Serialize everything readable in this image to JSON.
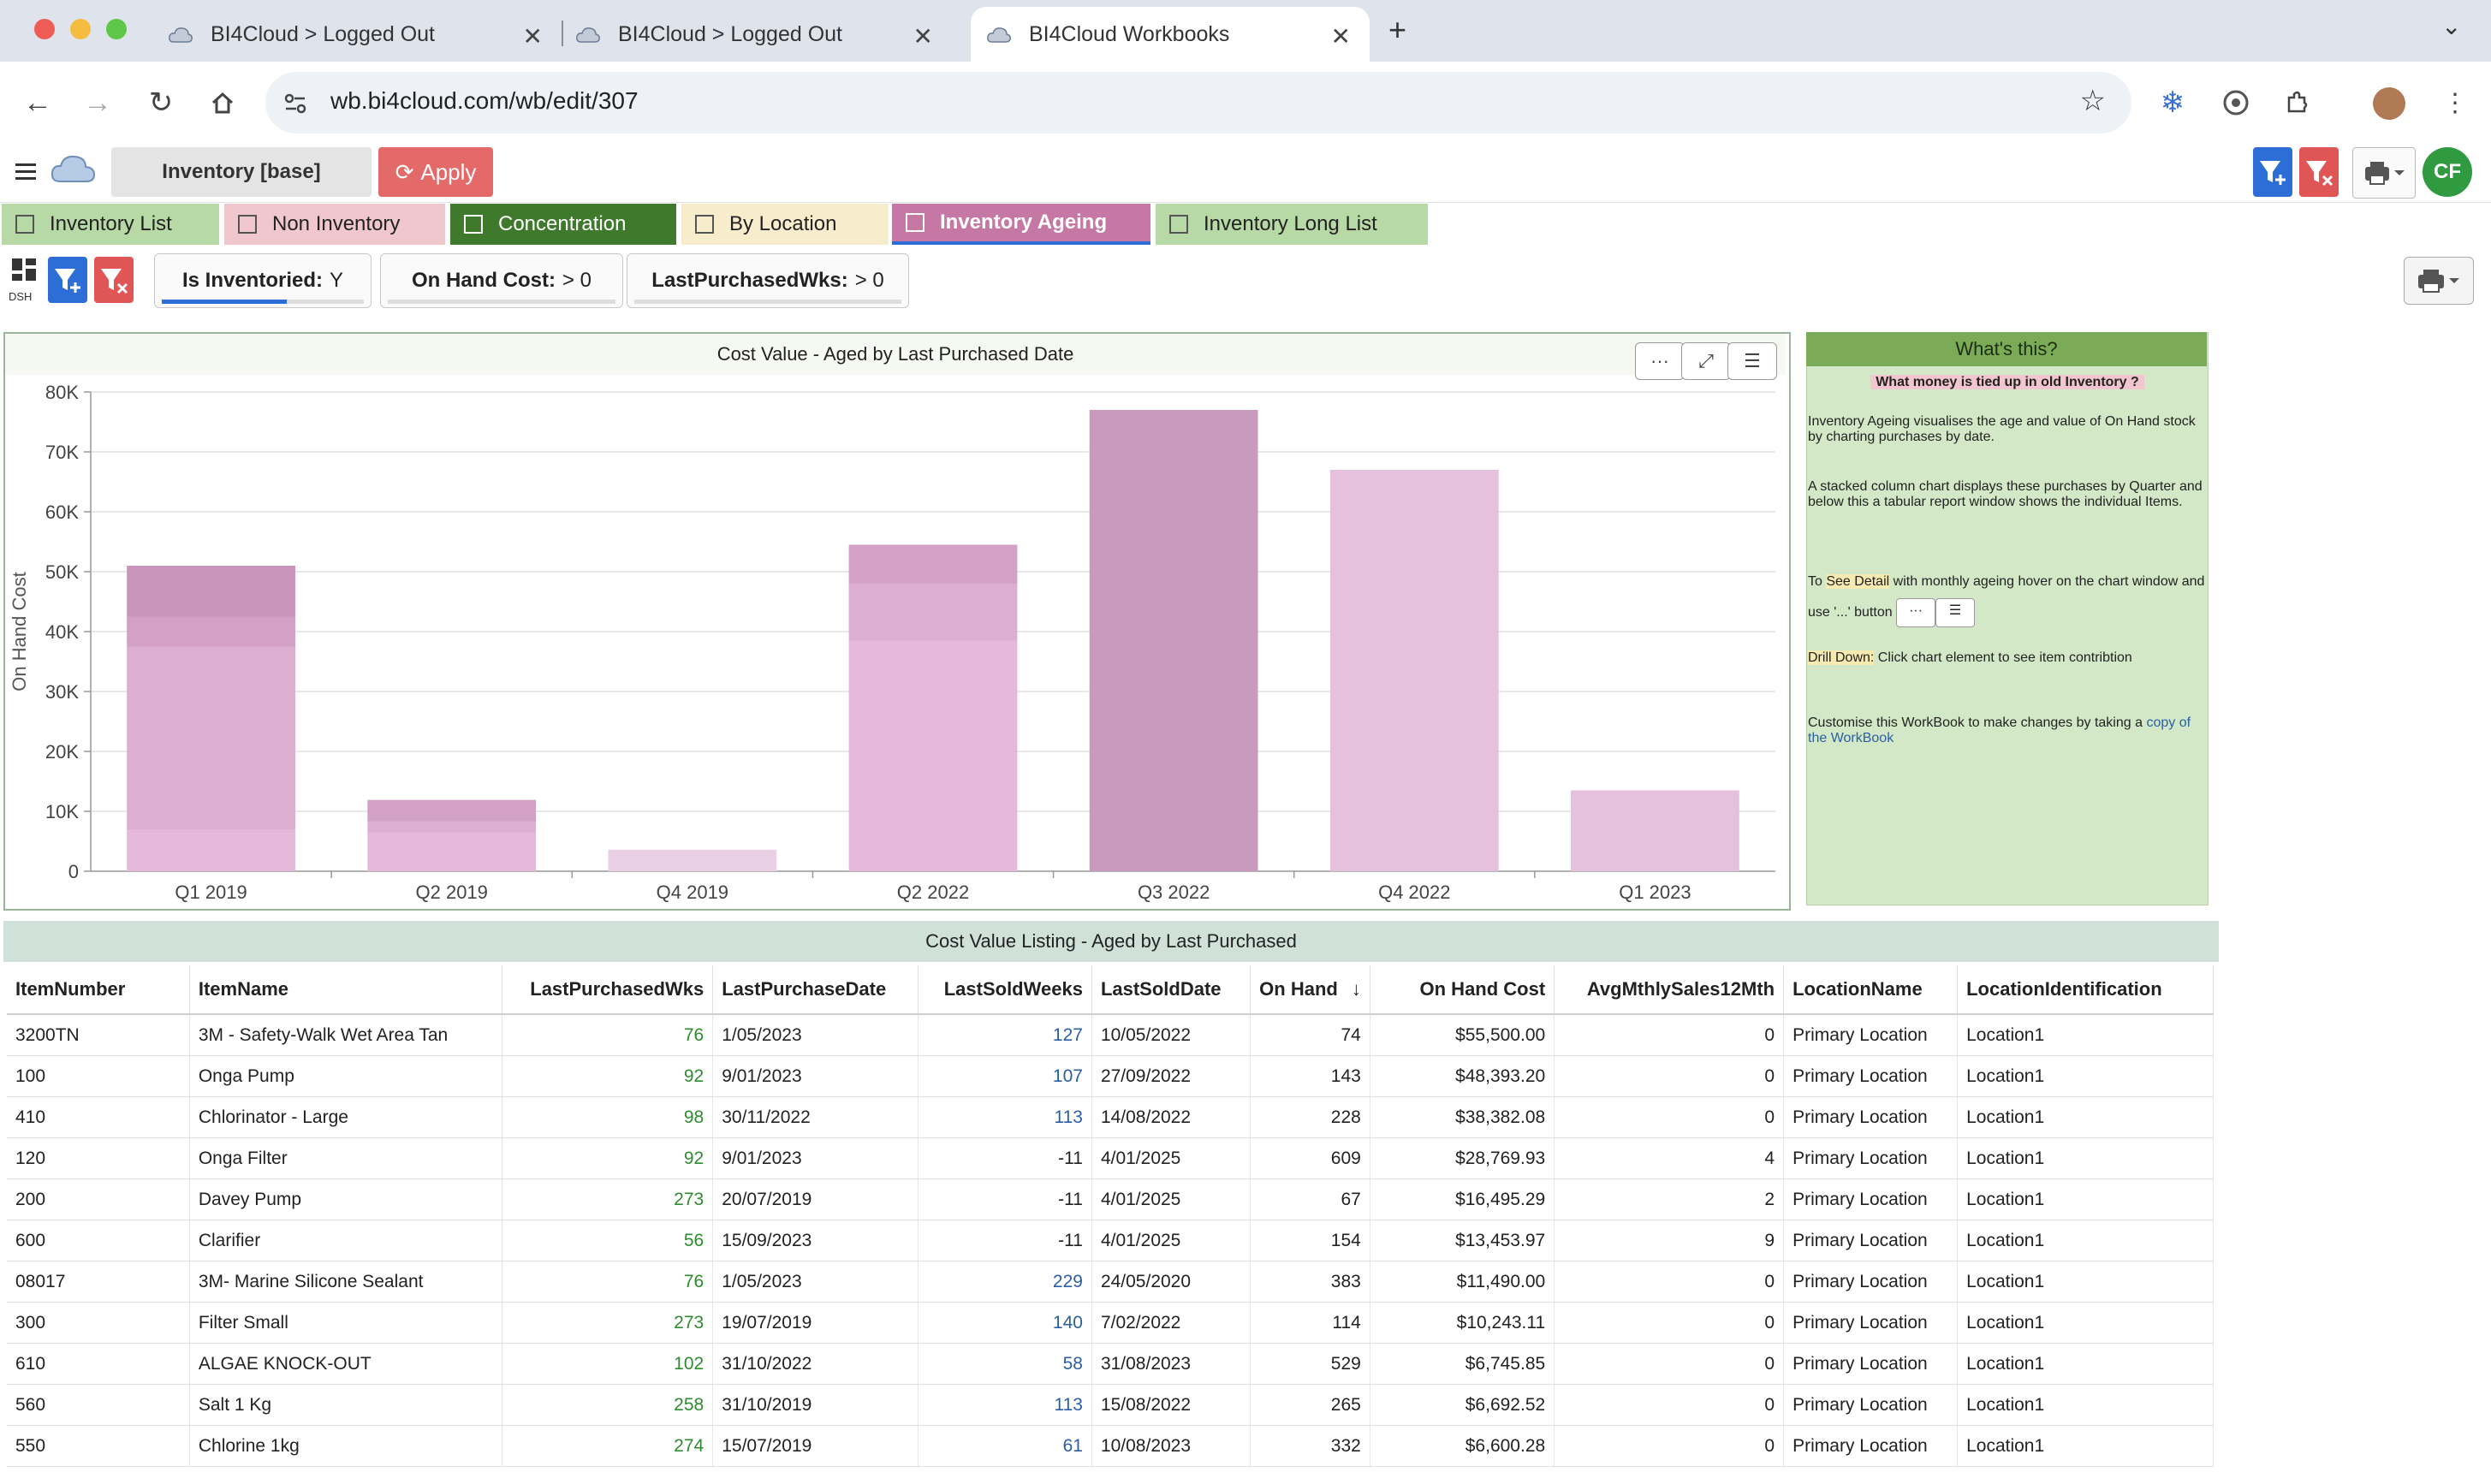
{
  "browser": {
    "tabs": [
      {
        "title": "BI4Cloud > Logged Out"
      },
      {
        "title": "BI4Cloud > Logged Out"
      },
      {
        "title": "BI4Cloud Workbooks"
      }
    ],
    "url": "wb.bi4cloud.com/wb/edit/307"
  },
  "app": {
    "workbook_name": "Inventory [base]",
    "apply_label": "Apply",
    "avatar_initials": "CF",
    "dsh_label": "DSH"
  },
  "workbook_tabs": [
    {
      "label": "Inventory List",
      "color": "#b7d9a5"
    },
    {
      "label": "Non Inventory",
      "color": "#efc7cc"
    },
    {
      "label": "Concentration",
      "color": "#3f7a2c"
    },
    {
      "label": "By Location",
      "color": "#f7eccb"
    },
    {
      "label": "Inventory Ageing",
      "color": "#c678a5"
    },
    {
      "label": "Inventory Long List",
      "color": "#b7d9a5"
    }
  ],
  "filters": [
    {
      "name": "Is Inventoried:",
      "value": "Y"
    },
    {
      "name": "On Hand Cost:",
      "value": "> 0"
    },
    {
      "name": "LastPurchasedWks:",
      "value": "> 0"
    }
  ],
  "chart_data": {
    "type": "bar",
    "title": "Cost Value - Aged by Last Purchased Date",
    "xlabel": "",
    "ylabel": "On Hand Cost",
    "ylim": [
      0,
      80000
    ],
    "yticks": [
      "0",
      "10K",
      "20K",
      "30K",
      "40K",
      "50K",
      "60K",
      "70K",
      "80K"
    ],
    "categories": [
      "Q1 2019",
      "Q2 2019",
      "Q4 2019",
      "Q2 2022",
      "Q3 2022",
      "Q4 2022",
      "Q1 2023"
    ],
    "stacked": true,
    "stacks": [
      [
        7000,
        30500,
        5000,
        8500
      ],
      [
        6500,
        1800,
        3600
      ],
      [
        3600
      ],
      [
        38500,
        9500,
        6500
      ],
      [
        77000
      ],
      [
        67000
      ],
      [
        13500
      ]
    ],
    "colors": [
      "#e4b9d9",
      "#dcaed0",
      "#d3a1c5",
      "#c994b9"
    ]
  },
  "info": {
    "header": "What's this?",
    "question": "What money is tied up in old Inventory ?",
    "p1": "Inventory Ageing visualises the age and value of On Hand stock by charting purchases by date.",
    "p2": "A stacked column chart displays these purchases by Quarter and below this a tabular report window shows the individual Items.",
    "p3_pre": "To",
    "p3_hl": "See Detail",
    "p3_post": " with monthly ageing  hover on the chart window and use '...' button",
    "p4_hl": "Drill Down:",
    "p4_post": " Click chart element to see item contribtion",
    "p5_pre": "Customise this WorkBook to make changes by taking a ",
    "p5_link": "copy of the WorkBook"
  },
  "table": {
    "title": "Cost Value Listing - Aged by Last Purchased",
    "columns": [
      "ItemNumber",
      "ItemName",
      "LastPurchasedWks",
      "LastPurchaseDate",
      "LastSoldWeeks",
      "LastSoldDate",
      "On Hand",
      "On Hand Cost",
      "AvgMthlySales12Mth",
      "LocationName",
      "LocationIdentification"
    ],
    "sort_indicator": "↓",
    "rows": [
      [
        "3200TN",
        "3M - Safety-Walk Wet Area Tan",
        "76",
        "1/05/2023",
        "127",
        "10/05/2022",
        "74",
        "$55,500.00",
        "0",
        "Primary Location",
        "Location1"
      ],
      [
        "100",
        "Onga Pump",
        "92",
        "9/01/2023",
        "107",
        "27/09/2022",
        "143",
        "$48,393.20",
        "0",
        "Primary Location",
        "Location1"
      ],
      [
        "410",
        "Chlorinator - Large",
        "98",
        "30/11/2022",
        "113",
        "14/08/2022",
        "228",
        "$38,382.08",
        "0",
        "Primary Location",
        "Location1"
      ],
      [
        "120",
        "Onga Filter",
        "92",
        "9/01/2023",
        "-11",
        "4/01/2025",
        "609",
        "$28,769.93",
        "4",
        "Primary Location",
        "Location1"
      ],
      [
        "200",
        "Davey Pump",
        "273",
        "20/07/2019",
        "-11",
        "4/01/2025",
        "67",
        "$16,495.29",
        "2",
        "Primary Location",
        "Location1"
      ],
      [
        "600",
        "Clarifier",
        "56",
        "15/09/2023",
        "-11",
        "4/01/2025",
        "154",
        "$13,453.97",
        "9",
        "Primary Location",
        "Location1"
      ],
      [
        "08017",
        "3M- Marine Silicone Sealant",
        "76",
        "1/05/2023",
        "229",
        "24/05/2020",
        "383",
        "$11,490.00",
        "0",
        "Primary Location",
        "Location1"
      ],
      [
        "300",
        "Filter Small",
        "273",
        "19/07/2019",
        "140",
        "7/02/2022",
        "114",
        "$10,243.11",
        "0",
        "Primary Location",
        "Location1"
      ],
      [
        "610",
        "ALGAE KNOCK-OUT",
        "102",
        "31/10/2022",
        "58",
        "31/08/2023",
        "529",
        "$6,745.85",
        "0",
        "Primary Location",
        "Location1"
      ],
      [
        "560",
        "Salt 1 Kg",
        "258",
        "31/10/2019",
        "113",
        "15/08/2022",
        "265",
        "$6,692.52",
        "0",
        "Primary Location",
        "Location1"
      ],
      [
        "550",
        "Chlorine 1kg",
        "274",
        "15/07/2019",
        "61",
        "10/08/2023",
        "332",
        "$6,600.28",
        "0",
        "Primary Location",
        "Location1"
      ]
    ]
  }
}
